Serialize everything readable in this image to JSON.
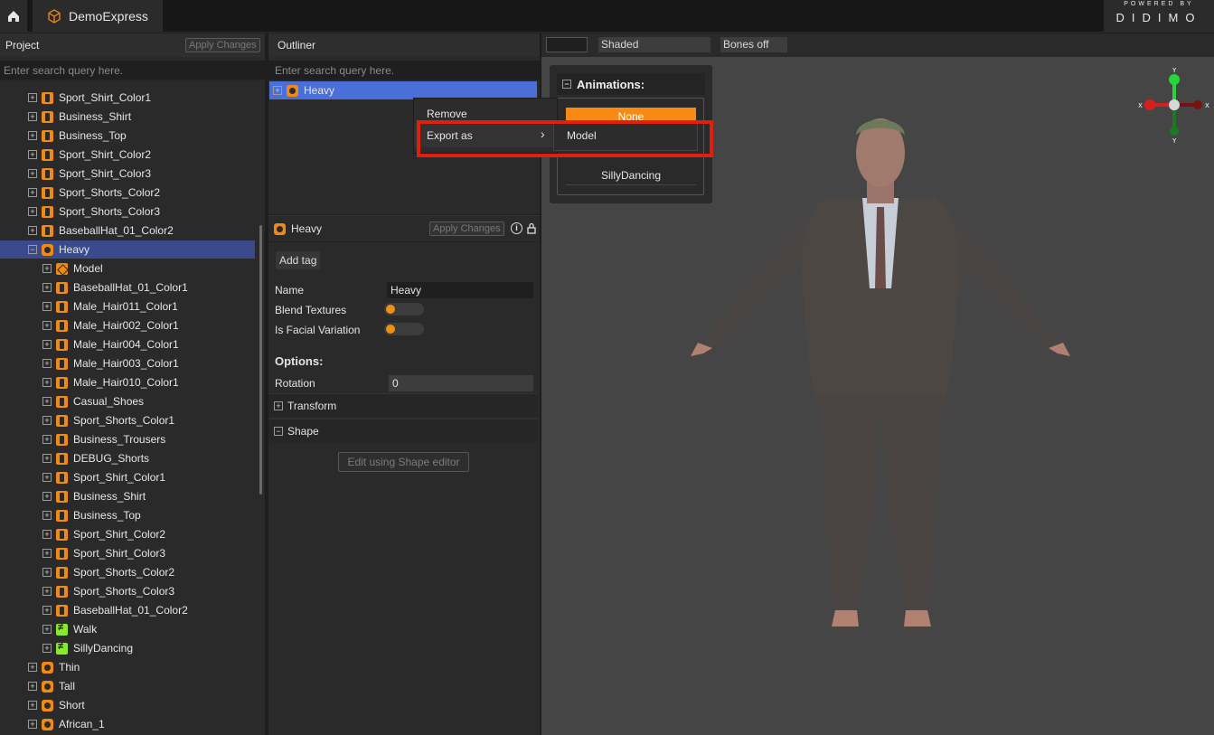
{
  "topbar": {
    "app_name": "DemoExpress",
    "brand_top": "POWERED BY",
    "brand_name": "DIDIMO"
  },
  "project": {
    "title": "Project",
    "apply_label": "Apply Changes",
    "search_placeholder": "Enter search query here.",
    "items": [
      {
        "label": "Sport_Shirt_Color1",
        "icon": "shirt-icon",
        "depth": 1
      },
      {
        "label": "Business_Shirt",
        "icon": "shirt-icon",
        "depth": 1
      },
      {
        "label": "Business_Top",
        "icon": "shirt-icon",
        "depth": 1
      },
      {
        "label": "Sport_Shirt_Color2",
        "icon": "shirt-icon",
        "depth": 1
      },
      {
        "label": "Sport_Shirt_Color3",
        "icon": "shirt-icon",
        "depth": 1
      },
      {
        "label": "Sport_Shorts_Color2",
        "icon": "shirt-icon",
        "depth": 1
      },
      {
        "label": "Sport_Shorts_Color3",
        "icon": "shirt-icon",
        "depth": 1
      },
      {
        "label": "BaseballHat_01_Color2",
        "icon": "shirt-icon",
        "depth": 1
      },
      {
        "label": "Heavy",
        "icon": "character-icon",
        "depth": 1,
        "expanded": true,
        "selected": true
      },
      {
        "label": "Model",
        "icon": "model-icon",
        "depth": 2
      },
      {
        "label": "BaseballHat_01_Color1",
        "icon": "shirt-icon",
        "depth": 2
      },
      {
        "label": "Male_Hair011_Color1",
        "icon": "shirt-icon",
        "depth": 2
      },
      {
        "label": "Male_Hair002_Color1",
        "icon": "shirt-icon",
        "depth": 2
      },
      {
        "label": "Male_Hair004_Color1",
        "icon": "shirt-icon",
        "depth": 2
      },
      {
        "label": "Male_Hair003_Color1",
        "icon": "shirt-icon",
        "depth": 2
      },
      {
        "label": "Male_Hair010_Color1",
        "icon": "shirt-icon",
        "depth": 2
      },
      {
        "label": "Casual_Shoes",
        "icon": "shirt-icon",
        "depth": 2
      },
      {
        "label": "Sport_Shorts_Color1",
        "icon": "shirt-icon",
        "depth": 2
      },
      {
        "label": "Business_Trousers",
        "icon": "shirt-icon",
        "depth": 2
      },
      {
        "label": "DEBUG_Shorts",
        "icon": "shirt-icon",
        "depth": 2
      },
      {
        "label": "Sport_Shirt_Color1",
        "icon": "shirt-icon",
        "depth": 2
      },
      {
        "label": "Business_Shirt",
        "icon": "shirt-icon",
        "depth": 2
      },
      {
        "label": "Business_Top",
        "icon": "shirt-icon",
        "depth": 2
      },
      {
        "label": "Sport_Shirt_Color2",
        "icon": "shirt-icon",
        "depth": 2
      },
      {
        "label": "Sport_Shirt_Color3",
        "icon": "shirt-icon",
        "depth": 2
      },
      {
        "label": "Sport_Shorts_Color2",
        "icon": "shirt-icon",
        "depth": 2
      },
      {
        "label": "Sport_Shorts_Color3",
        "icon": "shirt-icon",
        "depth": 2
      },
      {
        "label": "BaseballHat_01_Color2",
        "icon": "shirt-icon",
        "depth": 2
      },
      {
        "label": "Walk",
        "icon": "animation-icon",
        "depth": 2
      },
      {
        "label": "SillyDancing",
        "icon": "animation-icon",
        "depth": 2
      },
      {
        "label": "Thin",
        "icon": "character-icon",
        "depth": 1
      },
      {
        "label": "Tall",
        "icon": "character-icon",
        "depth": 1
      },
      {
        "label": "Short",
        "icon": "character-icon",
        "depth": 1
      },
      {
        "label": "African_1",
        "icon": "character-icon",
        "depth": 1
      }
    ]
  },
  "outliner": {
    "title": "Outliner",
    "search_placeholder": "Enter search query here.",
    "item_label": "Heavy"
  },
  "context_menu": {
    "remove": "Remove",
    "export_as": "Export as",
    "arrow": "›",
    "submenu_model": "Model"
  },
  "inspector": {
    "title": "Heavy",
    "apply_label": "Apply Changes",
    "add_tag": "Add tag",
    "name_label": "Name",
    "name_value": "Heavy",
    "blend_label": "Blend Textures",
    "facial_label": "Is Facial Variation",
    "options_label": "Options:",
    "rotation_label": "Rotation",
    "rotation_value": "0",
    "transform_label": "Transform",
    "shape_label": "Shape",
    "shape_editor_btn": "Edit using Shape editor"
  },
  "viewport": {
    "shading": "Shaded",
    "bones": "Bones off",
    "animations_title": "Animations:",
    "anim_none": "None",
    "anim_silly": "SillyDancing",
    "gizmo_y": "Y",
    "gizmo_x": "X"
  },
  "colors": {
    "accent": "#f08a13",
    "selection": "#3a4a8c",
    "highlight": "#e0200d"
  }
}
